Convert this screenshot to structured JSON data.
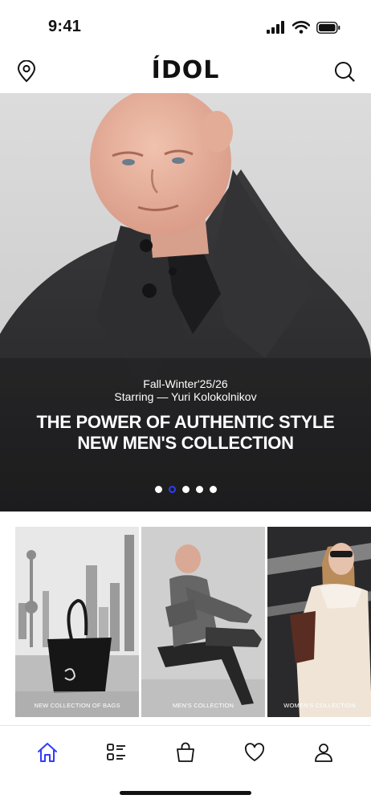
{
  "status_bar": {
    "time": "9:41"
  },
  "header": {
    "brand": "ÍDOL"
  },
  "hero": {
    "subtitle_line1": "Fall-Winter'25/26",
    "subtitle_line2": "Starring — Yuri Kolokolnikov",
    "title_line1": "THE POWER OF AUTHENTIC STYLE",
    "title_line2": "NEW MEN'S COLLECTION",
    "slide_count": 5,
    "active_slide": 2
  },
  "categories": [
    {
      "label": "NEW COLLECTION OF BAGS"
    },
    {
      "label": "MEN'S COLLECTION"
    },
    {
      "label": "WOMEN'S COLLECTION"
    }
  ],
  "tabbar": {
    "items": [
      "home",
      "catalog",
      "bag",
      "favorites",
      "profile"
    ],
    "active": "home",
    "active_color": "#2f3cff"
  }
}
